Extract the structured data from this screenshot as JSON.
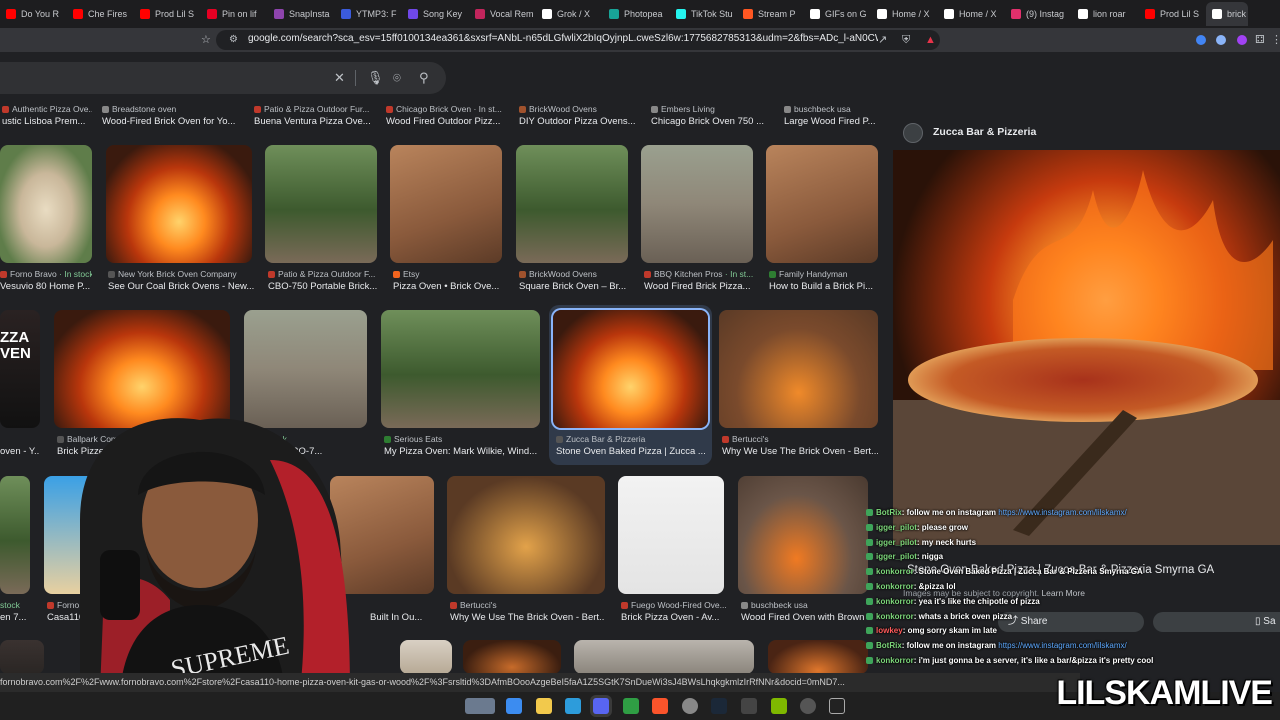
{
  "tabs": [
    {
      "label": "Do You R",
      "color": "#ff0000"
    },
    {
      "label": "Che Fires",
      "color": "#ff0000"
    },
    {
      "label": "Prod Lil S",
      "color": "#ff0000"
    },
    {
      "label": "Pin on lif",
      "color": "#e60023"
    },
    {
      "label": "SnapInsta",
      "color": "#8e44ad"
    },
    {
      "label": "YTMP3: F",
      "color": "#3b5bdb"
    },
    {
      "label": "Song Key",
      "color": "#7048e8"
    },
    {
      "label": "Vocal Rem",
      "color": "#c2255c"
    },
    {
      "label": "Grok / X",
      "color": "#ffffff"
    },
    {
      "label": "Photopea",
      "color": "#18a497"
    },
    {
      "label": "TikTok Stu",
      "color": "#25f4ee"
    },
    {
      "label": "Stream P",
      "color": "#ff5722"
    },
    {
      "label": "GIFs on G",
      "color": "#ffffff"
    },
    {
      "label": "Home / X",
      "color": "#ffffff"
    },
    {
      "label": "Home / X",
      "color": "#ffffff"
    },
    {
      "label": "(9) Instag",
      "color": "#e1306c"
    },
    {
      "label": "lion roar",
      "color": "#ffffff"
    },
    {
      "label": "Prod Lil S",
      "color": "#ff0000"
    },
    {
      "label": "brick",
      "color": "#ffffff"
    }
  ],
  "address_bar": {
    "url": "google.com/search?sca_esv=15ff0100134ea361&sxsrf=ANbL-n65dLGfwliX2bIqOyjnpL.cweSzl6w:1775682785313&udm=2&fbs=ADc_l-aN0CWEZBOHj..."
  },
  "results_row1": [
    {
      "source": "Authentic Pizza Ove...",
      "title": "ustic Lisboa Prem...",
      "color": "#c0392b"
    },
    {
      "source": "Breadstone oven",
      "title": "Wood-Fired Brick Oven for Yo...",
      "color": "#888888"
    },
    {
      "source": "Patio & Pizza Outdoor Fur...",
      "title": "Buena Ventura Pizza Ove...",
      "color": "#c0392b"
    },
    {
      "source": "Chicago Brick Oven · In st...",
      "title": "Wood Fired Outdoor Pizz...",
      "color": "#c0392b"
    },
    {
      "source": "BrickWood Ovens",
      "title": "DIY Outdoor Pizza Ovens...",
      "color": "#a0522d"
    },
    {
      "source": "Embers Living",
      "title": "Chicago Brick Oven 750 ...",
      "color": "#888888"
    },
    {
      "source": "buschbeck usa",
      "title": "Large Wood Fired P...",
      "color": "#888888"
    }
  ],
  "results_row2": [
    {
      "source": "Forno Bravo",
      "stock": "· In stock",
      "title": "Vesuvio 80 Home P...",
      "color": "#c0392b"
    },
    {
      "source": "New York Brick Oven Company",
      "stock": "",
      "title": "See Our Coal Brick Ovens - New...",
      "color": "#555555"
    },
    {
      "source": "Patio & Pizza Outdoor F...",
      "stock": "",
      "title": "CBO-750 Portable Brick...",
      "color": "#c0392b"
    },
    {
      "source": "Etsy",
      "stock": "",
      "title": "Pizza Oven • Brick Ove...",
      "color": "#f1641e"
    },
    {
      "source": "BrickWood Ovens",
      "stock": "",
      "title": "Square Brick Oven – Br...",
      "color": "#a0522d"
    },
    {
      "source": "BBQ Kitchen Pros",
      "stock": "· In st...",
      "title": "Wood Fired Brick Pizza...",
      "color": "#c0392b"
    },
    {
      "source": "Family Handyman",
      "stock": "",
      "title": "How to Build a Brick Pi...",
      "color": "#2e7d32"
    }
  ],
  "results_row3": [
    {
      "source": "",
      "stock": "",
      "title": "oven - Y...",
      "color": "#555555"
    },
    {
      "source": "Ballpark Commons",
      "stock": "",
      "title": "Brick Pizzeria & Ris",
      "color": "#555555"
    },
    {
      "source": "",
      "stock": "n stock",
      "title": "Oven CBO-7...",
      "color": "#555555"
    },
    {
      "source": "Serious Eats",
      "stock": "",
      "title": "My Pizza Oven: Mark Wilkie, Wind...",
      "color": "#2e7d32"
    },
    {
      "source": "Zucca Bar & Pizzeria",
      "stock": "",
      "title": "Stone Oven Baked Pizza | Zucca ...",
      "color": "#555555"
    },
    {
      "source": "Bertucci's",
      "stock": "",
      "title": "Why We Use The Brick Oven - Bert...",
      "color": "#c0392b"
    }
  ],
  "results_row4": [
    {
      "source": "",
      "stock": "stock",
      "title": "en 7...",
      "color": "#555555"
    },
    {
      "source": "Forno B",
      "stock": "",
      "title": "Casa110",
      "color": "#c0392b"
    },
    {
      "source": "",
      "stock": "",
      "title": "Built In Ou...",
      "color": "#555555"
    },
    {
      "source": "Bertucci's",
      "stock": "",
      "title": "Why We Use The Brick Oven - Bert...",
      "color": "#c0392b"
    },
    {
      "source": "Fuego Wood-Fired Ove...",
      "stock": "",
      "title": "Brick Pizza Oven - Av...",
      "color": "#c0392b"
    },
    {
      "source": "buschbeck usa",
      "stock": "",
      "title": "Wood Fired Oven with Brown",
      "color": "#888888"
    }
  ],
  "side_panel": {
    "site_name": "Zucca Bar & Pizzeria",
    "title": "Stone Oven Baked Pizza | Zucca Bar & Pizzeria Smyrna GA",
    "copyright": "Images may be subject to copyright.",
    "learn_more": "Learn More",
    "share_label": "Share",
    "save_label": "Sa"
  },
  "chat": [
    {
      "user": "BotRix",
      "message": ": follow me on instagram",
      "link": "https://www.instagram.com/lilskamx/"
    },
    {
      "user": "igger_pilot",
      "message": ": please grow",
      "link": ""
    },
    {
      "user": "igger_pilot",
      "message": ": my neck hurts",
      "link": ""
    },
    {
      "user": "igger_pilot",
      "message": ": nigga",
      "link": ""
    },
    {
      "user": "konkorror",
      "message": ": Stone Oven Baked Pizza | Zucca Bar & Pizzeria Smyrna GA",
      "link": ""
    },
    {
      "user": "konkorror",
      "message": ": &pizza lol",
      "link": ""
    },
    {
      "user": "konkorror",
      "message": ": yea it's like the chipotle of pizza",
      "link": ""
    },
    {
      "user": "konkorror",
      "message": ": whats a brick oven pizza",
      "link": ""
    },
    {
      "user": "lowkey",
      "message": ": omg sorry skam im late",
      "link": ""
    },
    {
      "user": "BotRix",
      "message": ": follow me on instagram",
      "link": "https://www.instagram.com/lilskamx/"
    },
    {
      "user": "konkorror",
      "message": ": i'm just gonna be a server, it's like a bar/&pizza it's pretty cool",
      "link": ""
    }
  ],
  "status_url": "fornobravo.com%2F%2Fwww.fornobravo.com%2Fstore%2Fcasa110-home-pizza-oven-kit-gas-or-wood%2F%3Fsrsltid%3DAfmBOooAzgeBeI5faA1Z5SGtK7SnDueWi3sJ4BWsLhqkgkmlzIrRfNNr&docid=0mND7...",
  "watermark": "LILSKAMLIVE"
}
